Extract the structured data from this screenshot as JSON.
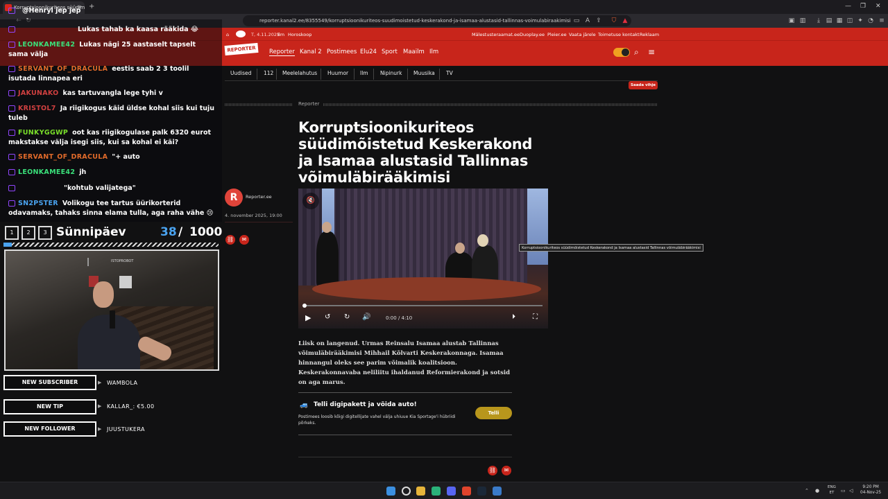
{
  "browser": {
    "tab_title": "Korruptsioonikuriteos süüdimõ...",
    "url": "reporter.kanal2.ee/8355549/korruptsioonikuriteos-suudimoistetud-keskerakond-ja-isamaa-alustasid-tallinnas-voimulabiraakimisi"
  },
  "site": {
    "topbar_date": "T, 4.11.2025",
    "topbar_links": [
      "Ilm",
      "Horoskoop"
    ],
    "topbar_right": [
      "Mälestusteraamat.ee",
      "Duoplay.ee",
      "Pleier.ee",
      "Vaata järele",
      "Toimetuse kontakt",
      "Reklaam"
    ],
    "logo": "REPORTER",
    "nav": [
      "Reporter",
      "Kanal 2",
      "Postimees",
      "Elu24",
      "Sport",
      "Maailm",
      "Ilm"
    ],
    "subnav": [
      "Uudised",
      "112",
      "Meelelahutus",
      "Huumor",
      "Ilm",
      "Nipinurk",
      "Muusika",
      "TV"
    ],
    "live_button": "Saada vihje"
  },
  "article": {
    "section": "Reporter",
    "headline": "Korruptsioonikuriteos süüdimõistetud Keskerakond ja Isamaa alustasid Tallinnas võimuläbirääkimisi",
    "author": "Reporter.ee",
    "avatar_letter": "R",
    "date": "4. november 2025, 19:00",
    "video_time": "0:00 / 4:10",
    "tooltip": "Korruptsioonikuriteos süüdimõistetud Keskerakond ja Isamaa alustasid Tallinnas võimuläbirääkimisi",
    "lede": "Liisk on langenud. Urmas Reinsalu Isamaa alustab Tallinnas võimuläbirääkimisi Mihhail Kõlvarti Keskerakonnaga. Isamaa hinnangul oleks see parim võimalik koalitsioon. Keskerakonnavaba neliliitu ihaldanud Reformierakond ja sotsid on aga marus.",
    "promo_title": "Telli digipakett ja võida auto!",
    "promo_text": "Postimees loosib kõigi digitellijate vahel välja uhiuue Kia Sportage'i hübriidi põrkeks.",
    "promo_button": "Telli"
  },
  "stream": {
    "chat": [
      {
        "user": "",
        "text": "@Henryl jep jep",
        "color": "#4aa3f0"
      },
      {
        "user": "",
        "text": "Lukas tahab ka kaasa rääkida 😂",
        "color": "#e0443a"
      },
      {
        "user": "LEONKAMEE42",
        "text": "Lukas nägi 25 aastaselt tapselt sama välja",
        "color": "#3ae07a"
      },
      {
        "user": "SERVANT_OF_DRACULA",
        "text": "eestis saab 2 3 toolil isutada linnapea eri",
        "color": "#e06a2a"
      },
      {
        "user": "JAKUNAKO",
        "text": "kas tartuvangla lege tyhi v",
        "color": "#d04040"
      },
      {
        "user": "KRISTOL7",
        "text": "Ja riigikogus käid üldse kohal siis kui tuju tuleb",
        "color": "#d04040"
      },
      {
        "user": "FUNKYGGWP",
        "text": "oot kas riigikogulase palk 6320 eurot makstakse välja isegi siis, kui sa kohal ei käi?",
        "color": "#7adf2a"
      },
      {
        "user": "SERVANT_OF_DRACULA",
        "text": "\"+ auto",
        "color": "#e06a2a"
      },
      {
        "user": "LEONKAMEE42",
        "text": "jh",
        "color": "#3ae07a"
      },
      {
        "user": "",
        "text": "\"kohtub valijatega\"",
        "color": "#6a5af0"
      },
      {
        "user": "SN2PSTER",
        "text": "Volikogu tee tartus üürikorterid odavamaks, tahaks sinna elama tulla, aga raha vähe 😢",
        "color": "#4aa3f0"
      }
    ],
    "goal_label": "Sünnipäev",
    "goal_current": 38,
    "goal_max": 1000,
    "goal_current_text": "38",
    "goal_sep": "/",
    "goal_max_text": "1000",
    "goal_boxes": [
      "1",
      "2",
      "3"
    ],
    "alerts": [
      {
        "label": "NEW SUBSCRIBER",
        "value": "WAMBOLA"
      },
      {
        "label": "NEW TIP",
        "value": "KALLAR_: €5.00"
      },
      {
        "label": "NEW FOLLOWER",
        "value": "JUUSTUKERA"
      }
    ],
    "cam_sign": "ISTOPROBOT"
  },
  "taskbar": {
    "lang": "ENG",
    "lang2": "ET",
    "time": "9:20 PM",
    "date": "04-Nov-25"
  }
}
